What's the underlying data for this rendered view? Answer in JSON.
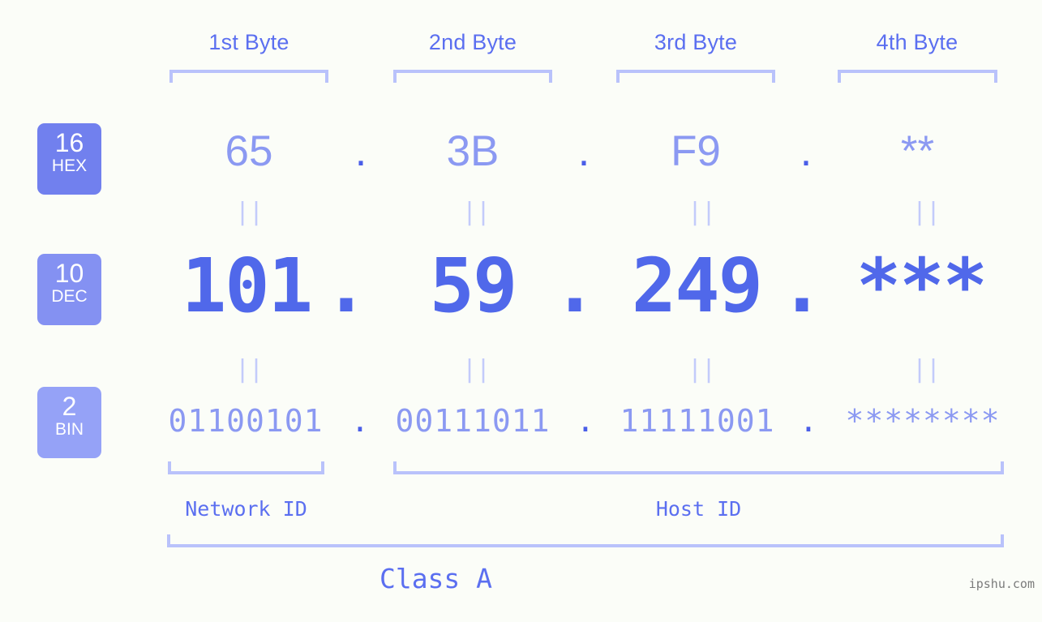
{
  "bytes": [
    {
      "header": "1st Byte"
    },
    {
      "header": "2nd Byte"
    },
    {
      "header": "3rd Byte"
    },
    {
      "header": "4th Byte"
    }
  ],
  "rows": {
    "hex": {
      "base": "16",
      "abbr": "HEX",
      "values": [
        "65",
        "3B",
        "F9",
        "**"
      ]
    },
    "dec": {
      "base": "10",
      "abbr": "DEC",
      "values": [
        "101",
        "59",
        "249",
        "***"
      ]
    },
    "bin": {
      "base": "2",
      "abbr": "BIN",
      "values": [
        "01100101",
        "00111011",
        "11111001",
        "********"
      ]
    }
  },
  "separator": ".",
  "equals_mark": "||",
  "segments": {
    "network_id": "Network ID",
    "host_id": "Host ID"
  },
  "class_label": "Class A",
  "watermark": "ipshu.com",
  "colors": {
    "background": "#fbfdf8",
    "accent": "#5b6ff0",
    "accent_light": "#8b99f2",
    "accent_pale": "#b9c2fb",
    "badge_hex": "#7180ee",
    "badge_dec": "#8491f2",
    "badge_bin": "#95a2f7",
    "dot": "#4a5ee8",
    "dec_value": "#5068ea",
    "watermark": "#7b7b7b"
  }
}
